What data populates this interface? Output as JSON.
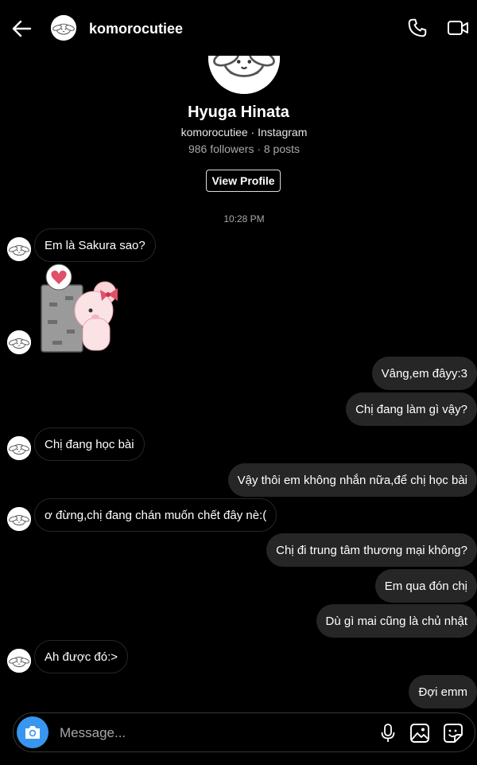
{
  "header": {
    "username": "komorocutiee"
  },
  "profile": {
    "name": "Hyuga Hinata",
    "subtitle": "komorocutiee · Instagram",
    "stats": "986 followers · 8 posts",
    "view_profile_label": "View Profile"
  },
  "thread": {
    "timestamp": "10:28 PM",
    "messages": [
      {
        "text": "Em là Sakura sao?",
        "side": "received"
      },
      {
        "text": "Vâng,em đâyy:3",
        "side": "sent"
      },
      {
        "text": "Chị đang làm gì vậy?",
        "side": "sent"
      },
      {
        "text": "Chị đang học bài",
        "side": "received"
      },
      {
        "text": "Vậy thôi em không nhắn nữa,để chị học bài",
        "side": "sent"
      },
      {
        "text": "ơ đừng,chị đang chán muốn chết đây nè:(",
        "side": "received"
      },
      {
        "text": "Chị đi trung tâm thương mại không?",
        "side": "sent"
      },
      {
        "text": "Em qua đón chị",
        "side": "sent"
      },
      {
        "text": "Dù gì mai cũng là chủ nhật",
        "side": "sent"
      },
      {
        "text": "Ah được đó:>",
        "side": "received"
      },
      {
        "text": "Đợi emm",
        "side": "sent"
      }
    ]
  },
  "composer": {
    "placeholder": "Message..."
  },
  "icons": {
    "back": "arrow-left-icon",
    "call": "phone-icon",
    "video": "video-camera-icon",
    "camera": "camera-icon",
    "mic": "microphone-icon",
    "gallery": "image-icon",
    "sticker": "sticker-icon"
  },
  "colors": {
    "background": "#000000",
    "sent_bubble": "#262626",
    "received_border": "#262626",
    "accent": "#3797f0",
    "muted_text": "#a8a8a8"
  }
}
